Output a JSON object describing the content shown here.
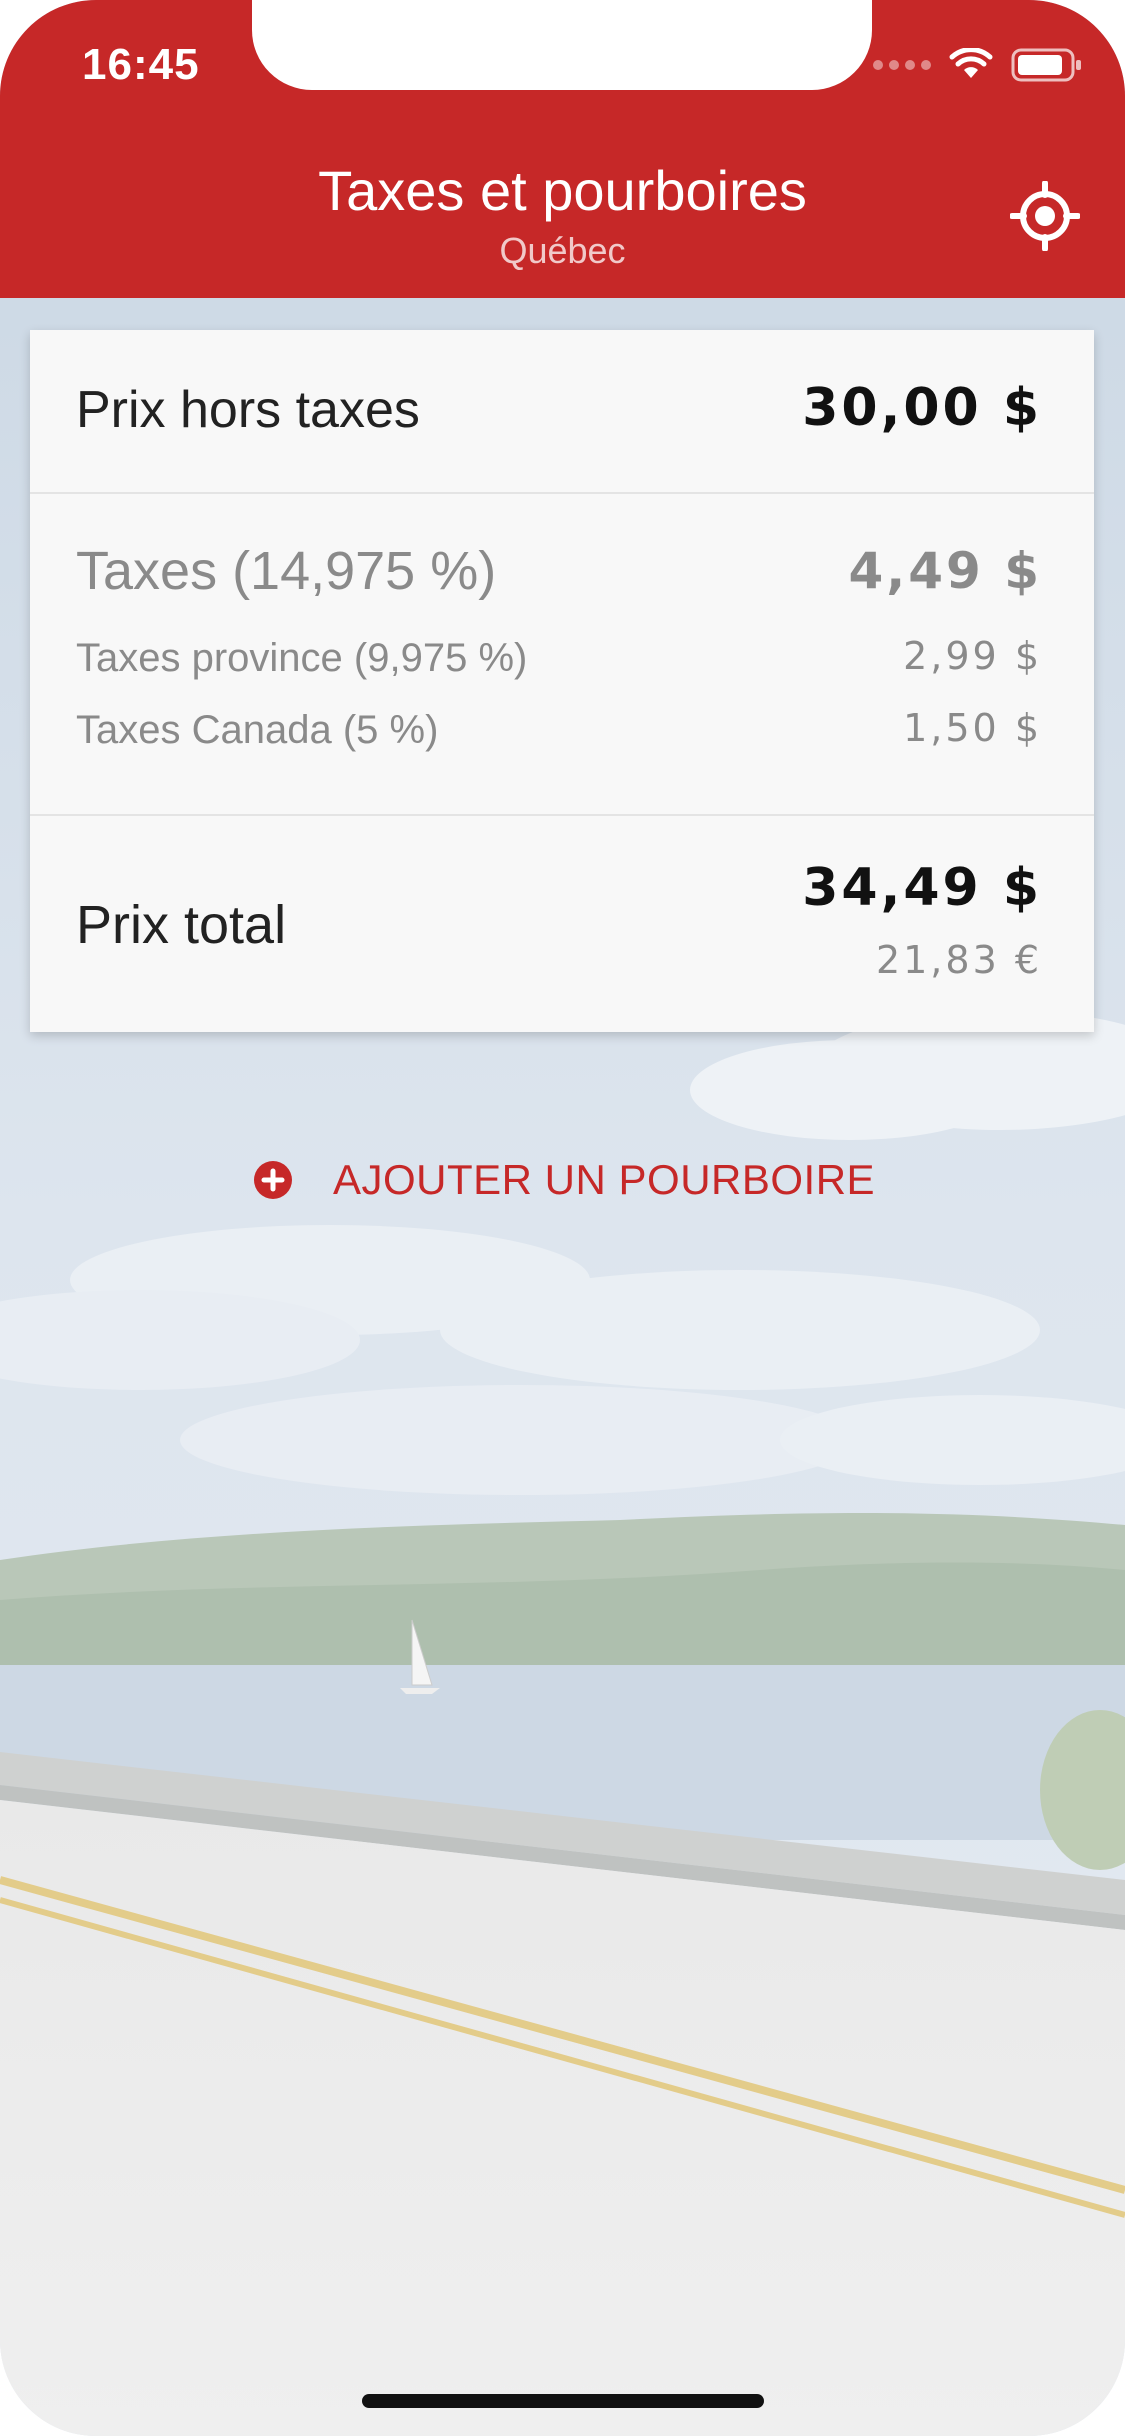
{
  "status_bar": {
    "time": "16:45"
  },
  "header": {
    "title": "Taxes et pourboires",
    "subtitle": "Québec",
    "locate_icon": "crosshair-location-icon",
    "color": "#c62828"
  },
  "summary": {
    "price": {
      "label": "Prix hors taxes",
      "value": "30,00 $"
    },
    "taxes": {
      "label": "Taxes (14,975 %)",
      "value": "4,49 $"
    },
    "tax_province": {
      "label": "Taxes province (9,975 %)",
      "value": "2,99 $"
    },
    "tax_canada": {
      "label": "Taxes Canada (5 %)",
      "value": "1,50 $"
    },
    "total": {
      "label": "Prix total",
      "value": "34,49 $",
      "value_eur": "21,83 €"
    }
  },
  "actions": {
    "add_tip_label": "AJOUTER UN POURBOIRE",
    "add_tip_icon": "plus-circle-icon"
  },
  "colors": {
    "accent": "#c62828",
    "card_background": "#f8f8f8",
    "secondary_text": "#8a8a8a"
  }
}
